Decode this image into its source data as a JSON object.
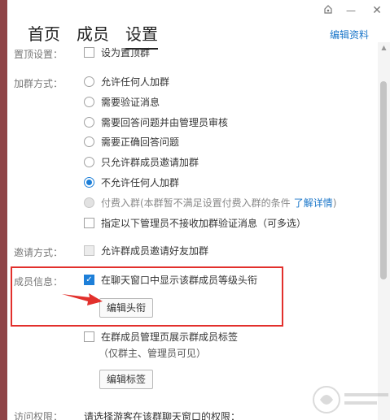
{
  "window": {
    "tabs": [
      {
        "label": "首页"
      },
      {
        "label": "成员"
      },
      {
        "label": "设置"
      }
    ],
    "edit_profile": "编辑资料",
    "controls": {
      "settings": "settings-icon",
      "minimize": "minimize-icon",
      "close": "close-icon"
    }
  },
  "settings": {
    "pin": {
      "label": "置顶设置：",
      "option": "设为置顶群"
    },
    "join": {
      "label": "加群方式：",
      "options": [
        "允许任何人加群",
        "需要验证消息",
        "需要回答问题并由管理员审核",
        "需要正确回答问题",
        "只允许群成员邀请加群",
        "不允许任何人加群"
      ],
      "paid_option": "付费入群(本群暂不满足设置付费入群的条件",
      "paid_link": "了解详情",
      "paid_close": ")",
      "admin_option": "指定以下管理员不接收加群验证消息（可多选）"
    },
    "invite": {
      "label": "邀请方式：",
      "option": "允许群成员邀请好友加群"
    },
    "member_info": {
      "label": "成员信息：",
      "show_title": "在聊天窗口中显示该群成员等级头衔",
      "edit_title_button": "编辑头衔",
      "show_tag": "在群成员管理页展示群成员标签",
      "tag_note": "（仅群主、管理员可见）",
      "edit_tag_button": "编辑标签"
    },
    "visitor": {
      "label": "访问权限：",
      "text": "请选择游客在该群聊天窗口的权限："
    }
  },
  "colors": {
    "accent": "#1d7fd8",
    "highlight": "#e2302c",
    "link": "#1a76c9"
  }
}
